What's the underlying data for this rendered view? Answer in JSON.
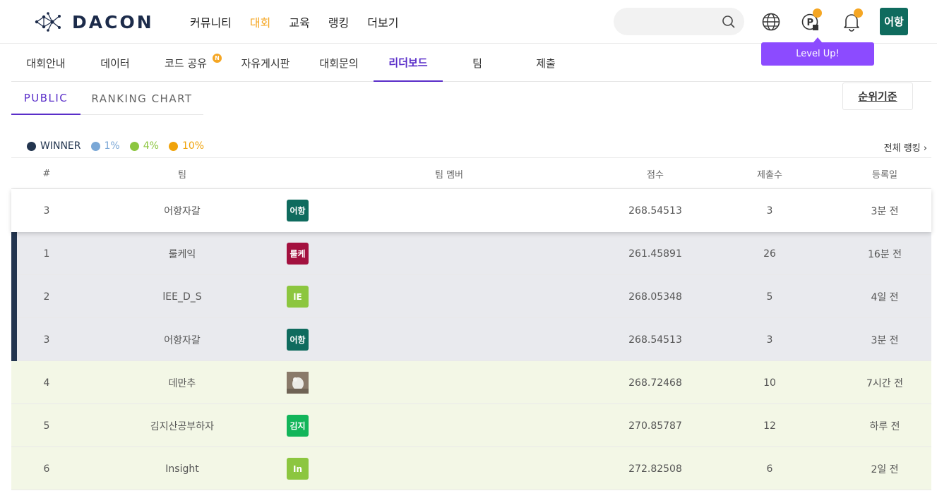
{
  "brand": {
    "name": "DACON"
  },
  "nav": {
    "items": [
      "커뮤니티",
      "대회",
      "교육",
      "랭킹",
      "더보기"
    ],
    "active_index": 1
  },
  "header": {
    "avatar_label": "어항",
    "tooltip": "Level Up!",
    "search_placeholder": ""
  },
  "subnav": {
    "tabs": [
      "대회안내",
      "데이터",
      "코드 공유",
      "자유게시판",
      "대회문의",
      "리더보드",
      "팀",
      "제출"
    ],
    "active": "리더보드",
    "new_badge": "N"
  },
  "board_tabs": {
    "public": "PUBLIC",
    "ranking_chart": "RANKING CHART"
  },
  "criteria_button": "순위기준",
  "legend": [
    {
      "label": "WINNER",
      "color": "#23354f"
    },
    {
      "label": "1%",
      "color": "#7aa7d6"
    },
    {
      "label": "4%",
      "color": "#8cc63f"
    },
    {
      "label": "10%",
      "color": "#f0a30a"
    }
  ],
  "full_ranking_link": "전체 랭킹",
  "table": {
    "headers": {
      "rank": "#",
      "team": "팀",
      "members": "팀 멤버",
      "score": "점수",
      "submissions": "제출수",
      "date": "등록일"
    },
    "my_row": {
      "rank": "3",
      "team": "어항자갈",
      "avatar": "어항",
      "avatar_color": "#0f6b5e",
      "score": "268.54513",
      "submissions": "3",
      "date": "3분 전"
    },
    "rows": [
      {
        "rank": "1",
        "team": "룰케익",
        "avatar": "룰케",
        "avatar_color": "#a3113f",
        "score": "261.45891",
        "submissions": "26",
        "date": "16분 전",
        "tier": "winner"
      },
      {
        "rank": "2",
        "team": "lEE_D_S",
        "avatar": "lE",
        "avatar_color": "#8cc63f",
        "score": "268.05348",
        "submissions": "5",
        "date": "4일 전",
        "tier": "winner"
      },
      {
        "rank": "3",
        "team": "어항자갈",
        "avatar": "어항",
        "avatar_color": "#0f6b5e",
        "score": "268.54513",
        "submissions": "3",
        "date": "3분 전",
        "tier": "winner"
      },
      {
        "rank": "4",
        "team": "데만추",
        "avatar": "",
        "avatar_color": "#b9a391",
        "score": "268.72468",
        "submissions": "10",
        "date": "7시간 전",
        "tier": "green"
      },
      {
        "rank": "5",
        "team": "김지산공부하자",
        "avatar": "김지",
        "avatar_color": "#12b55a",
        "score": "270.85787",
        "submissions": "12",
        "date": "하루 전",
        "tier": "green"
      },
      {
        "rank": "6",
        "team": "Insight",
        "avatar": "In",
        "avatar_color": "#8cc63f",
        "score": "272.82508",
        "submissions": "6",
        "date": "2일 전",
        "tier": "green"
      }
    ]
  }
}
